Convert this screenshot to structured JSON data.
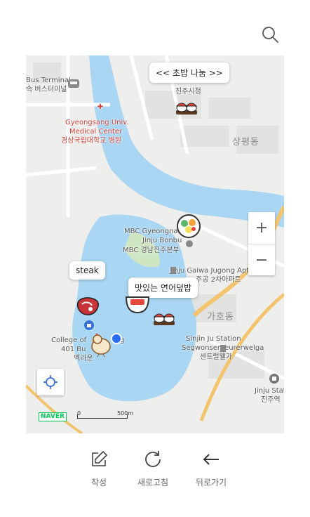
{
  "header": {
    "search_icon": "search-icon"
  },
  "map": {
    "labels": {
      "bus_terminal_en": "Bus Terminal",
      "bus_terminal_ko": "속 버스터미널",
      "hospital_en_1": "Gyeongsang Univ.",
      "hospital_en_2": "Medical Center",
      "hospital_ko": "경상국립대학교 병원",
      "city_hall": "진주시청",
      "district_1": "상평동",
      "mbc_en_1": "MBC Gyeongnam",
      "mbc_en_2": "Jinju Bonbu",
      "mbc_ko": "MBC 경남진주본부",
      "apt_en": "Jinju Gaiwa Jugong Apt.",
      "apt_ko": "주공 2차아파트",
      "district_2": "가호동",
      "college_1": "College of",
      "college_1b": "g",
      "college_2": "401 Bu",
      "college_3": "멕라운",
      "station_en_1": "Sinjin Ju Station",
      "station_en_2": "Segwonsenteurerwelga",
      "station_ko": "센트럴웰가",
      "jinju_station_en": "Jinju Stati",
      "jinju_station_ko": "진주역"
    },
    "bubbles": {
      "sushi": "<< 초밥 나눔 >>",
      "steak": "steak",
      "salmon": "맛있는 연어덮밥"
    },
    "markers": [
      "sushi-icon",
      "salad-bowl-icon",
      "steak-icon",
      "rice-bowl-icon",
      "sushi-icon",
      "chicken-icon"
    ],
    "zoom_in": "+",
    "zoom_out": "−",
    "naver_logo": "NAVER",
    "scale": {
      "start": "0",
      "end": "500m"
    },
    "colors": {
      "water": "#a9d6f2",
      "road": "#f3c46e",
      "land": "#eeeeec",
      "current_location": "#2a6cf0"
    }
  },
  "toolbar": {
    "write_label": "작성",
    "refresh_label": "새로고침",
    "back_label": "뒤로가기"
  }
}
